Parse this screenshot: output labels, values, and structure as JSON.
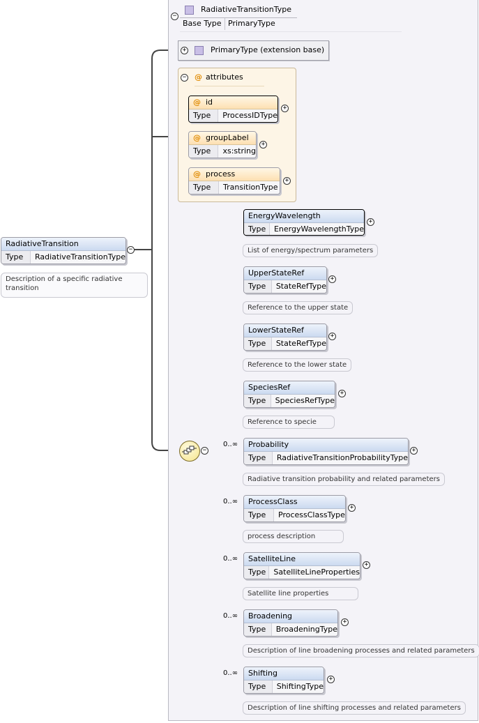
{
  "root": {
    "name": "RadiativeTransition",
    "type_key": "Type",
    "type_value": "RadiativeTransitionType",
    "doc": "Description of a specific radiative transition"
  },
  "complex_type": {
    "name": "RadiativeTransitionType",
    "base_type_key": "Base Type",
    "base_type_value": "PrimaryType",
    "extension_label": "PrimaryType (extension base)"
  },
  "attributes": {
    "title": "attributes",
    "items": [
      {
        "name": "id",
        "type_key": "Type",
        "type_value": "ProcessIDType"
      },
      {
        "name": "groupLabel",
        "type_key": "Type",
        "type_value": "xs:string"
      },
      {
        "name": "process",
        "type_key": "Type",
        "type_value": "TransitionType"
      }
    ]
  },
  "sequence": {
    "elements": [
      {
        "name": "EnergyWavelength",
        "type_key": "Type",
        "type_value": "EnergyWavelengthType",
        "occurs": "",
        "doc": "List of energy/spectrum parameters"
      },
      {
        "name": "UpperStateRef",
        "type_key": "Type",
        "type_value": "StateRefType",
        "occurs": "",
        "doc": "Reference to the upper state"
      },
      {
        "name": "LowerStateRef",
        "type_key": "Type",
        "type_value": "StateRefType",
        "occurs": "",
        "doc": "Reference to the lower state"
      },
      {
        "name": "SpeciesRef",
        "type_key": "Type",
        "type_value": "SpeciesRefType",
        "occurs": "",
        "doc": "Reference to specie"
      },
      {
        "name": "Probability",
        "type_key": "Type",
        "type_value": "RadiativeTransitionProbabilityType",
        "occurs": "0..∞",
        "doc": "Radiative transition probability and related parameters"
      },
      {
        "name": "ProcessClass",
        "type_key": "Type",
        "type_value": "ProcessClassType",
        "occurs": "0..∞",
        "doc": "process description"
      },
      {
        "name": "SatelliteLine",
        "type_key": "Type",
        "type_value": "SatelliteLineProperties",
        "occurs": "0..∞",
        "doc": "Satellite line properties"
      },
      {
        "name": "Broadening",
        "type_key": "Type",
        "type_value": "BroadeningType",
        "occurs": "0..∞",
        "doc": "Description of line broadening processes and related parameters"
      },
      {
        "name": "Shifting",
        "type_key": "Type",
        "type_value": "ShiftingType",
        "occurs": "0..∞",
        "doc": "Description of line shifting processes and related parameters"
      }
    ]
  },
  "icons": {
    "expand": "+",
    "collapse": "−",
    "attribute": "@"
  }
}
